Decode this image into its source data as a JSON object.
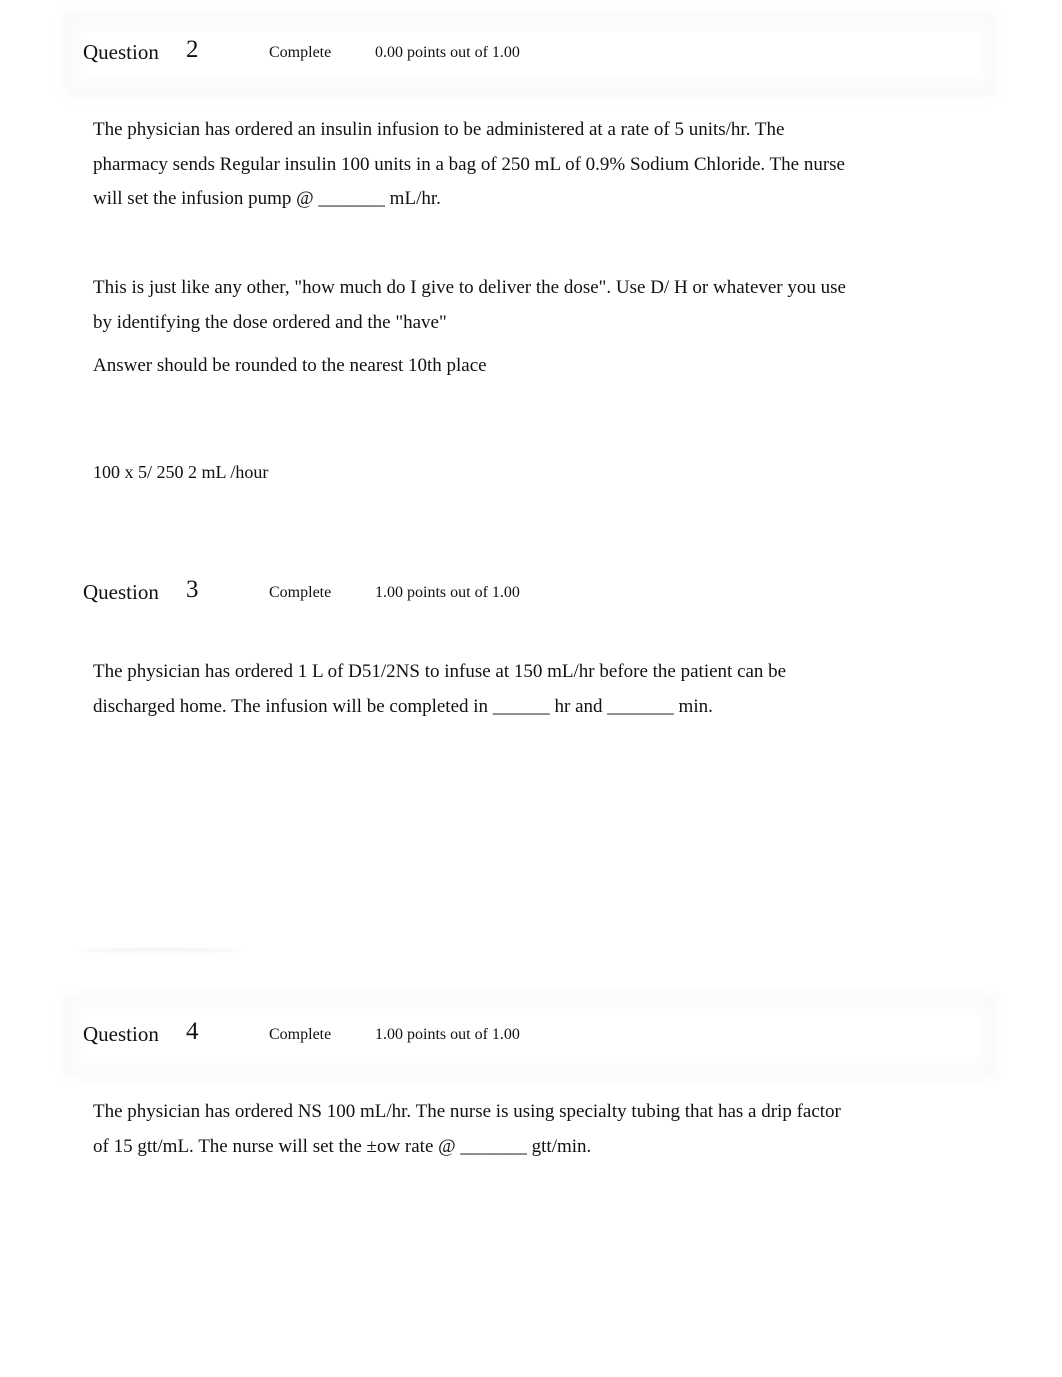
{
  "questions": [
    {
      "label": "Question",
      "number": "2",
      "state": "Complete",
      "grade": "0.00 points out of 1.00",
      "text_paragraphs": [
        "The physician has ordered an insulin infusion to be administered at a rate of 5 units/hr. The pharmacy sends Regular insulin 100 units in a bag of 250 mL of 0.9% Sodium Chloride. The nurse will set the infusion pump @ _______ mL/hr.",
        "This is just like any other, \"how much do I give to deliver the dose\". Use D/ H or whatever you use by identifying the dose ordered and the \"have\"",
        "Answer should be rounded to the nearest 10th place"
      ],
      "response": "100 x 5/ 250 2 mL /hour"
    },
    {
      "label": "Question",
      "number": "3",
      "state": "Complete",
      "grade": "1.00 points out of 1.00",
      "text_paragraphs": [
        "The physician has ordered 1 L of D51/2NS to infuse at 150 mL/hr before the patient can be discharged home. The infusion will be completed in ______ hr and _______ min."
      ]
    },
    {
      "label": "Question",
      "number": "4",
      "state": "Complete",
      "grade": "1.00 points out of 1.00",
      "text_paragraphs": [
        "The physician has ordered NS 100 mL/hr. The nurse is using specialty tubing that has a drip factor of 15 gtt/mL. The nurse will set the ±ow rate @ _______ gtt/min."
      ]
    }
  ]
}
